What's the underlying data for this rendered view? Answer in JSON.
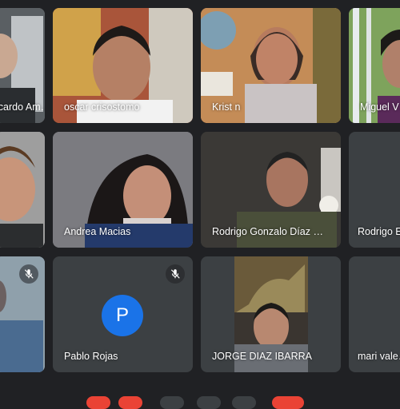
{
  "participants": [
    {
      "name": "Ricardo Am…",
      "muted": false
    },
    {
      "name": "oscar crisostomo",
      "muted": false
    },
    {
      "name": "Krist n",
      "muted": false
    },
    {
      "name": "Miguel V…",
      "muted": false
    },
    {
      "name": "",
      "muted": false
    },
    {
      "name": "Andrea Macias",
      "muted": false
    },
    {
      "name": "Rodrigo Gonzalo Díaz …",
      "muted": false
    },
    {
      "name": "Rodrigo E…",
      "muted": false
    },
    {
      "name": "",
      "muted": true
    },
    {
      "name": "Pablo Rojas",
      "muted": true,
      "avatar_letter": "P"
    },
    {
      "name": "JORGE DIAZ IBARRA",
      "muted": false
    },
    {
      "name": "mari vale…",
      "muted": false
    }
  ],
  "colors": {
    "background": "#202124",
    "tile": "#3c4043",
    "avatar": "#1a73e8",
    "leave": "#ea4335"
  },
  "icons": {
    "mute": "mic-off-icon"
  }
}
